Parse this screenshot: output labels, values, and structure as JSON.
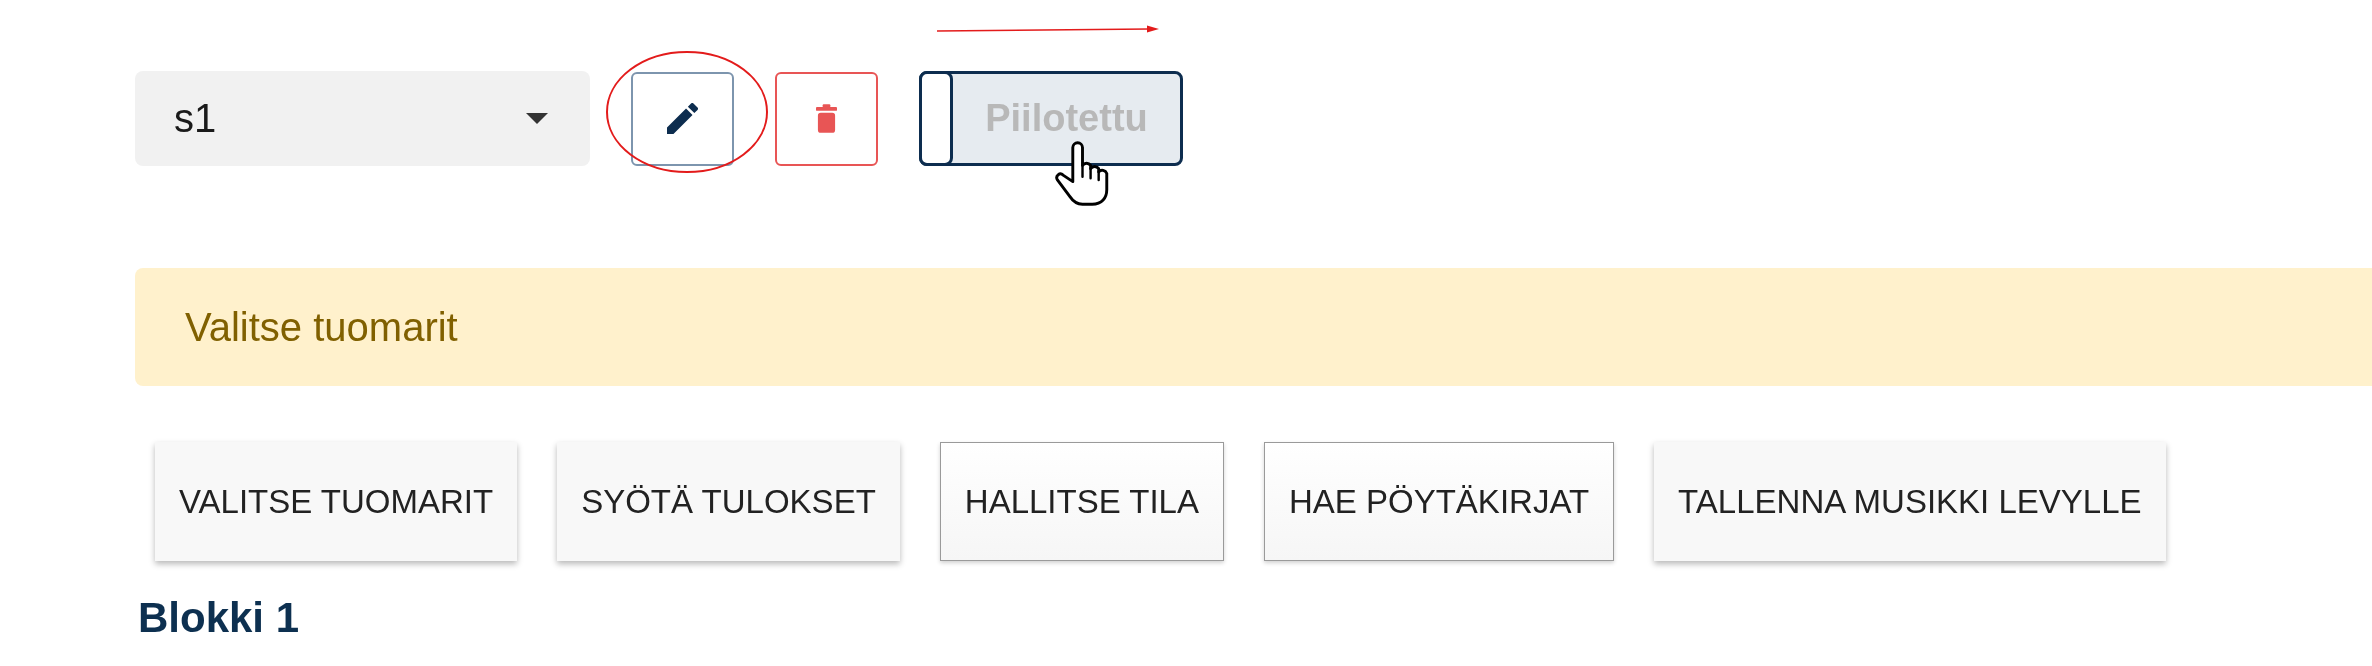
{
  "selector": {
    "value": "s1"
  },
  "visibility_toggle": {
    "label": "Piilotettu",
    "on": false
  },
  "alert": {
    "text": "Valitse tuomarit"
  },
  "buttons": [
    {
      "label": "VALITSE TUOMARIT",
      "kind": "raised"
    },
    {
      "label": "SYÖTÄ TULOKSET",
      "kind": "raised"
    },
    {
      "label": "HALLITSE TILA",
      "kind": "outlined"
    },
    {
      "label": "HAE PÖYTÄKIRJAT",
      "kind": "outlined"
    },
    {
      "label": "TALLENNA MUSIKKI LEVYLLE",
      "kind": "raised"
    }
  ],
  "heading": "Blokki 1"
}
